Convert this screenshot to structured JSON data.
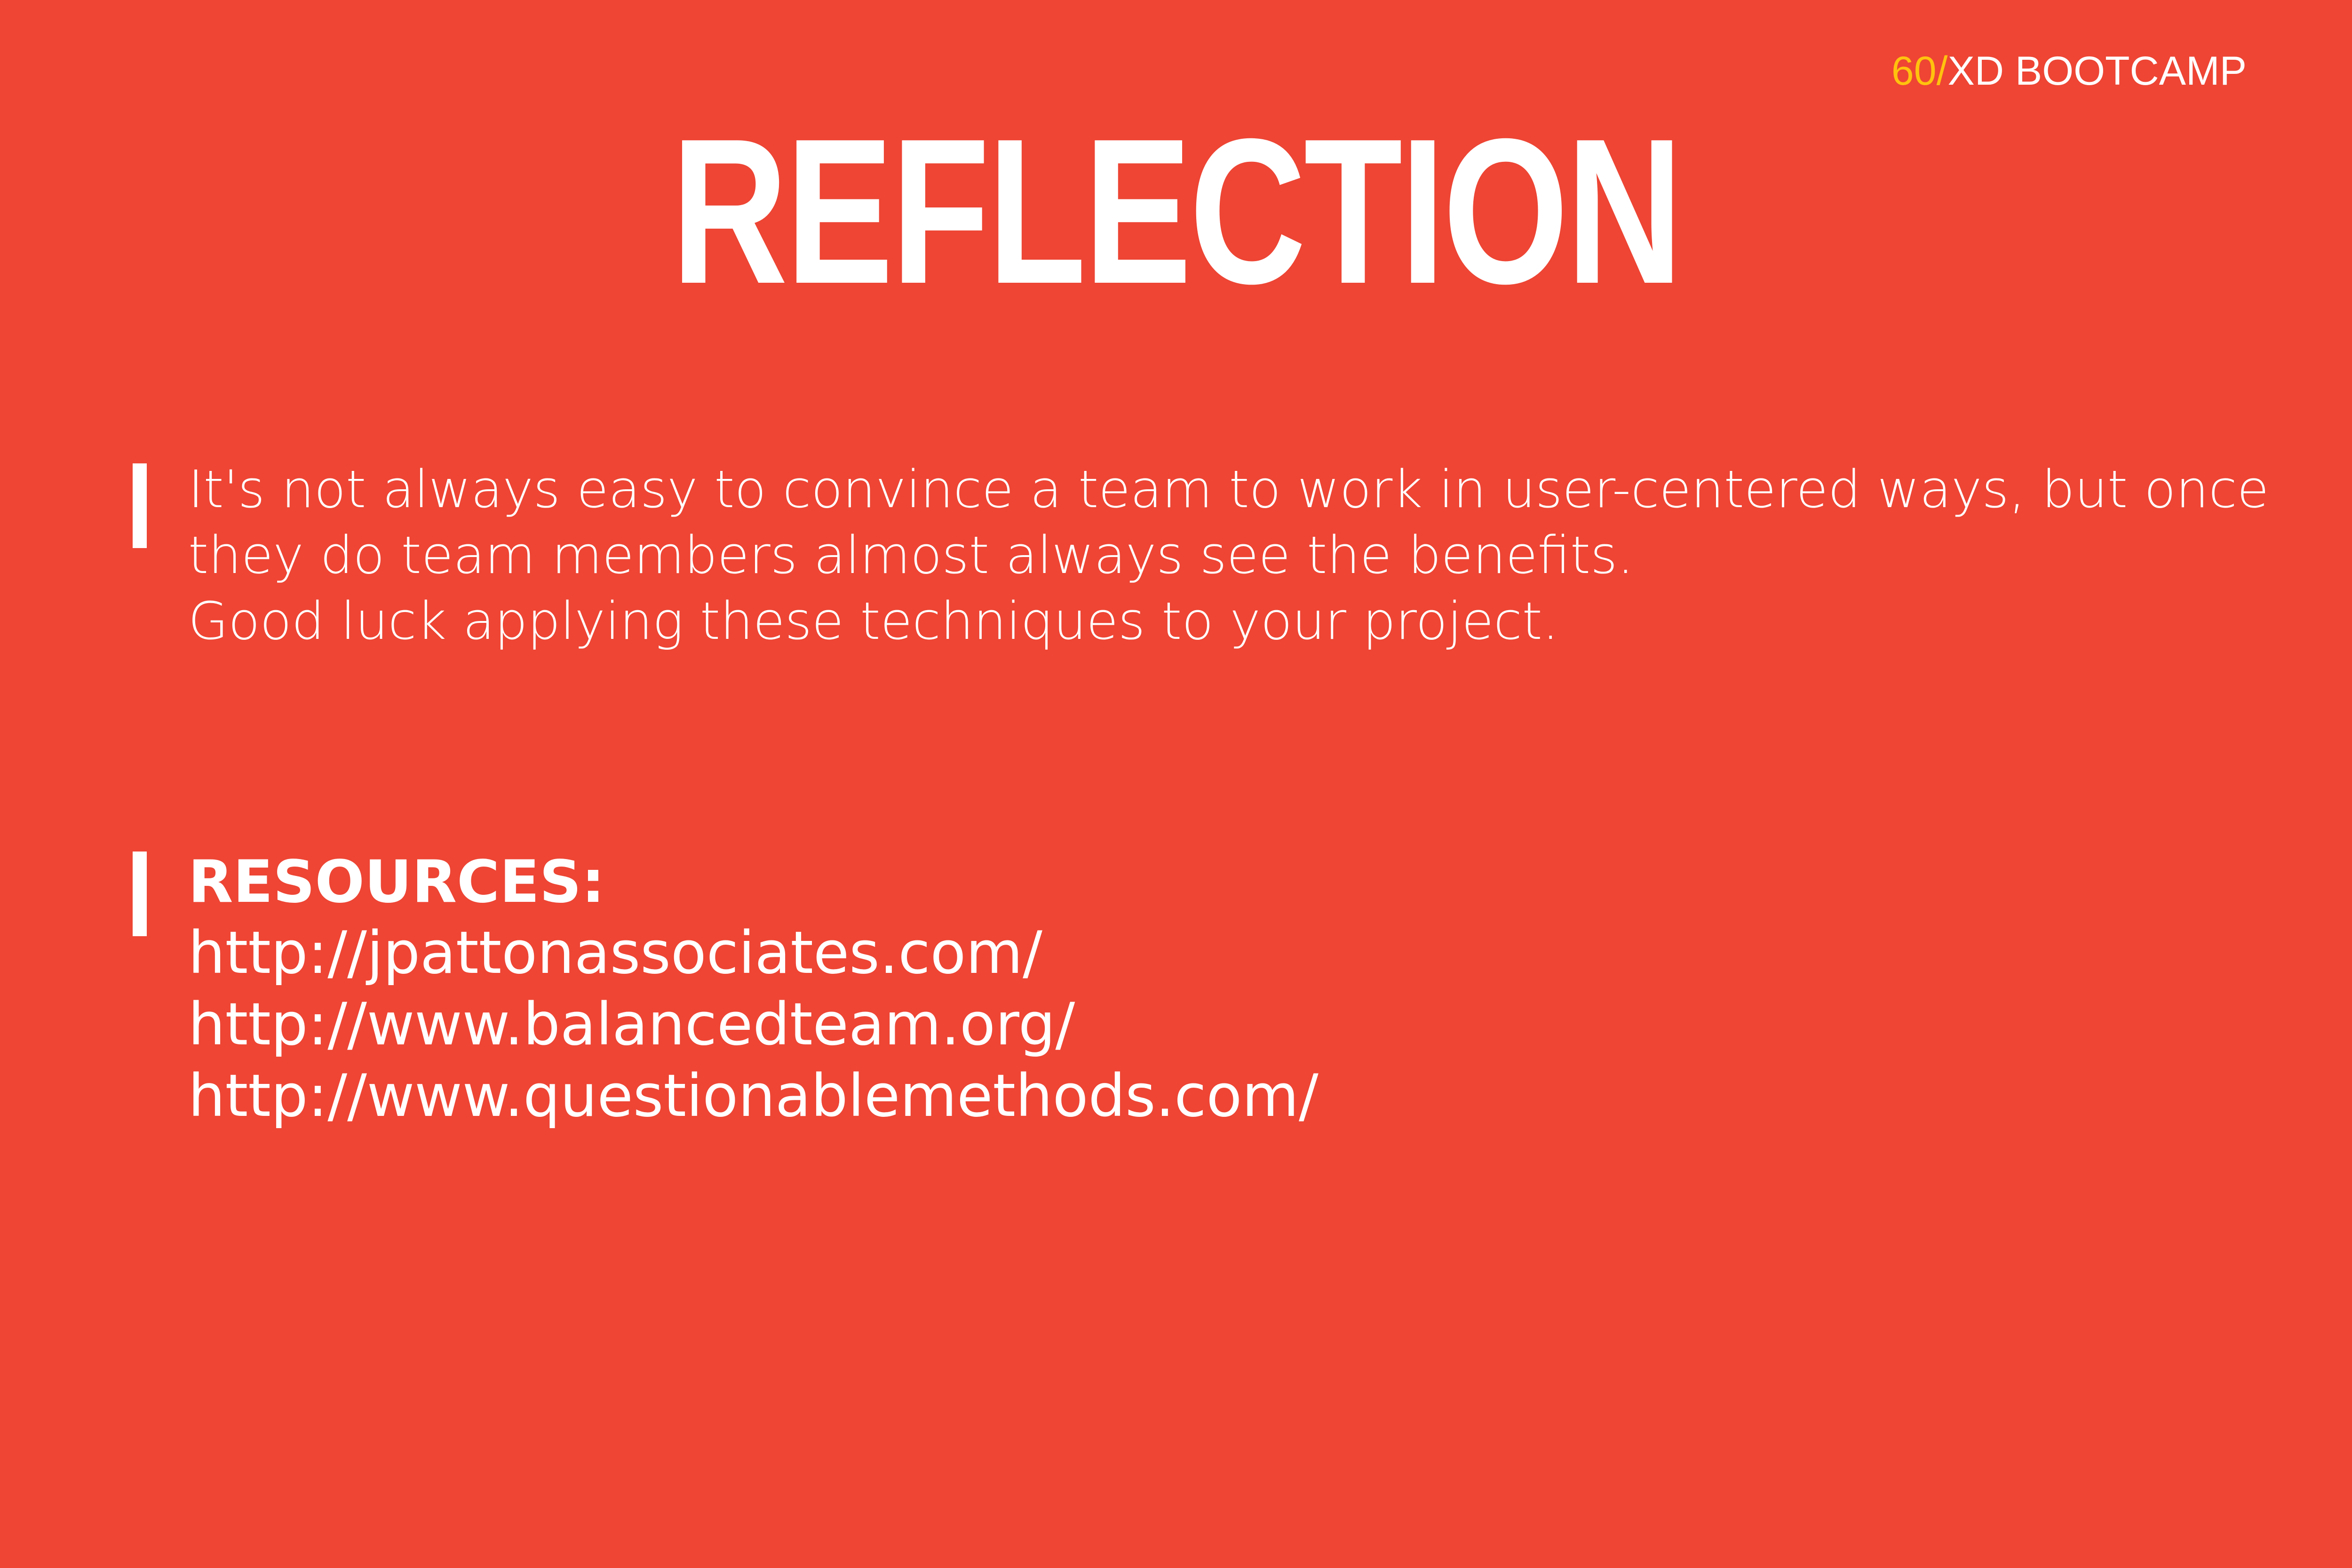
{
  "brand": {
    "number": "60/",
    "name": "XD BOOTCAMP",
    "number_color": "#ffc20e"
  },
  "title": "REFLECTION",
  "quote": {
    "lines": [
      "It's not always easy to convince a team to work in user-centered ways, but once",
      "they do team members almost always see the benefits.",
      "Good luck applying these techniques to your project."
    ]
  },
  "resources": {
    "heading": "RESOURCES:",
    "links": [
      "http://jpattonassociates.com/",
      "http://www.balancedteam.org/",
      "http://www.questionablemethods.com/"
    ]
  },
  "colors": {
    "background": "#ee4534",
    "text": "#ffffff"
  }
}
